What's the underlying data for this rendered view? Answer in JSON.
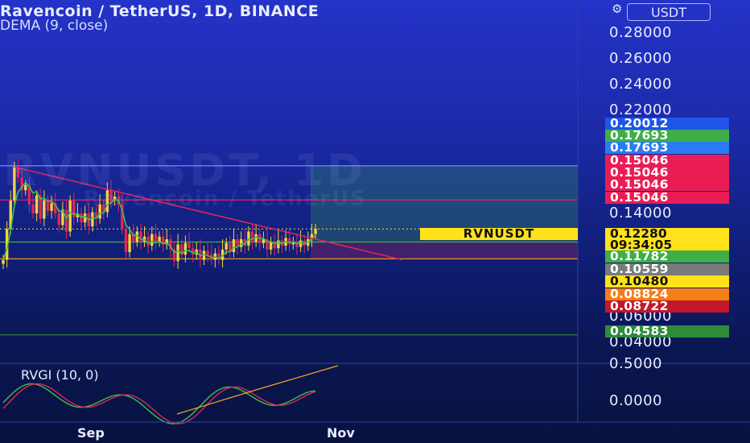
{
  "header": {
    "title": "Ravencoin / TetherUS, 1D, BINANCE",
    "indicator": "DEMA (9, close)",
    "watermark": "RVNUSDT, 1D",
    "watermark_sub": "Ravencoin / TetherUS",
    "currency_button": "USDT",
    "gear_icon": "gear-icon"
  },
  "price_axis": {
    "ticks": [
      "0.28000",
      "0.26000",
      "0.24000",
      "0.22000",
      "0.14000",
      "0.06000",
      "0.04000"
    ],
    "tick_values": [
      0.28,
      0.26,
      0.24,
      0.22,
      0.14,
      0.06,
      0.04
    ]
  },
  "price_badges": [
    {
      "label": "0.20012",
      "value": 0.20012,
      "bg": "#1e55e8",
      "fg": "#ffffff"
    },
    {
      "label": "0.17693",
      "value": 0.17693,
      "bg": "#3fae49",
      "fg": "#ffffff"
    },
    {
      "label": "0.17693",
      "value": 0.17693,
      "bg": "#2a7cf2",
      "fg": "#ffffff"
    },
    {
      "label": "0.15046",
      "value": 0.15046,
      "bg": "#e91d54",
      "fg": "#ffffff"
    },
    {
      "label": "0.15046",
      "value": 0.15046,
      "bg": "#e91d54",
      "fg": "#ffffff"
    },
    {
      "label": "0.15046",
      "value": 0.15046,
      "bg": "#e91d54",
      "fg": "#ffffff"
    },
    {
      "label": "0.15046",
      "value": 0.15046,
      "bg": "#e91d54",
      "fg": "#ffffff"
    },
    {
      "label": "0.11782",
      "value": 0.11782,
      "bg": "#3fae49",
      "fg": "#ffffff"
    },
    {
      "label": "0.10559",
      "value": 0.10559,
      "bg": "#7a7a7a",
      "fg": "#ffffff"
    },
    {
      "label": "0.10480",
      "value": 0.1048,
      "bg": "#ffe21a",
      "fg": "#111111"
    },
    {
      "label": "0.08824",
      "value": 0.08824,
      "bg": "#f57f17",
      "fg": "#ffffff"
    },
    {
      "label": "0.08722",
      "value": 0.08722,
      "bg": "#c2182b",
      "fg": "#ffffff"
    },
    {
      "label": "0.04583",
      "value": 0.04583,
      "bg": "#2e8b3a",
      "fg": "#ffffff"
    }
  ],
  "current_price": {
    "symbol": "RVNUSDT",
    "price": "0.12280",
    "countdown": "09:34:05",
    "value": 0.1228
  },
  "rvgi": {
    "label": "RVGI (10, 0)",
    "ticks": [
      "0.5000",
      "0.0000"
    ]
  },
  "time_axis": {
    "ticks": [
      "Sep",
      "Nov"
    ]
  },
  "colors": {
    "up": "#f5d536",
    "down": "#e0265a",
    "dema": "#3fc04a",
    "trend": "#e0265a",
    "accent": "#ffe21a"
  },
  "chart_data": {
    "type": "candlestick",
    "title": "Ravencoin / TetherUS, 1D, BINANCE",
    "ylim": [
      0.035,
      0.295
    ],
    "levels": [
      0.17693,
      0.15046,
      0.11782,
      0.1048,
      0.04583
    ],
    "closes": [
      0.104,
      0.128,
      0.15,
      0.176,
      0.168,
      0.158,
      0.162,
      0.147,
      0.14,
      0.154,
      0.136,
      0.15,
      0.142,
      0.148,
      0.14,
      0.131,
      0.143,
      0.126,
      0.15,
      0.137,
      0.14,
      0.133,
      0.14,
      0.13,
      0.141,
      0.136,
      0.147,
      0.141,
      0.158,
      0.15,
      0.153,
      0.147,
      0.128,
      0.11,
      0.124,
      0.118,
      0.126,
      0.118,
      0.122,
      0.115,
      0.124,
      0.118,
      0.122,
      0.116,
      0.12,
      0.112,
      0.103,
      0.116,
      0.108,
      0.117,
      0.113,
      0.108,
      0.112,
      0.104,
      0.111,
      0.108,
      0.104,
      0.109,
      0.104,
      0.112,
      0.117,
      0.11,
      0.12,
      0.114,
      0.12,
      0.115,
      0.126,
      0.118,
      0.124,
      0.117,
      0.12,
      0.112,
      0.118,
      0.113,
      0.119,
      0.115,
      0.121,
      0.116,
      0.118,
      0.114,
      0.119,
      0.115,
      0.12,
      0.124,
      0.128
    ]
  }
}
